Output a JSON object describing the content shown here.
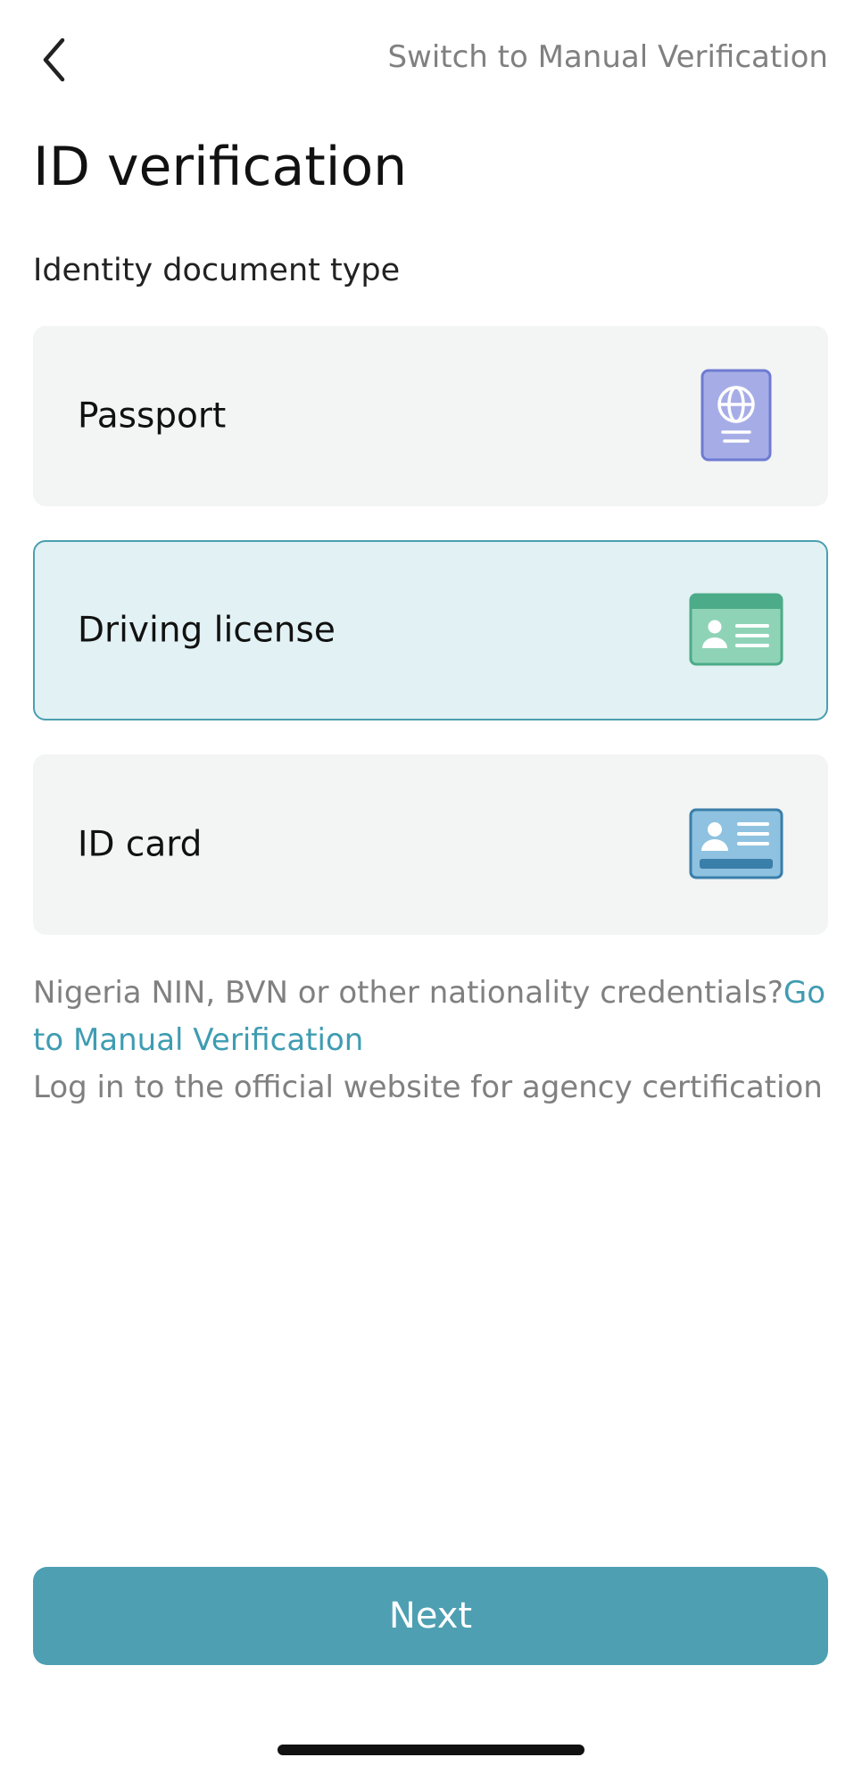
{
  "header": {
    "back_icon": "chevron-left-icon",
    "switch_link": "Switch to Manual Verification"
  },
  "page": {
    "title": "ID verification",
    "section_label": "Identity document type"
  },
  "document_types": [
    {
      "label": "Passport",
      "icon": "passport-icon",
      "selected": false
    },
    {
      "label": "Driving license",
      "icon": "driving-license-icon",
      "selected": true
    },
    {
      "label": "ID card",
      "icon": "id-card-icon",
      "selected": false
    }
  ],
  "info": {
    "question": "Nigeria NIN, BVN or other nationality credentials?",
    "link": "Go to Manual Verification",
    "note": "Log in to the official website for agency certification"
  },
  "footer": {
    "next_label": "Next"
  },
  "colors": {
    "accent": "#4e9fb2",
    "link": "#3f9cb2",
    "selected_bg": "#e2f1f3",
    "selected_border": "#4b9fb0",
    "card_bg": "#f3f4f4",
    "muted_text": "#808080"
  }
}
